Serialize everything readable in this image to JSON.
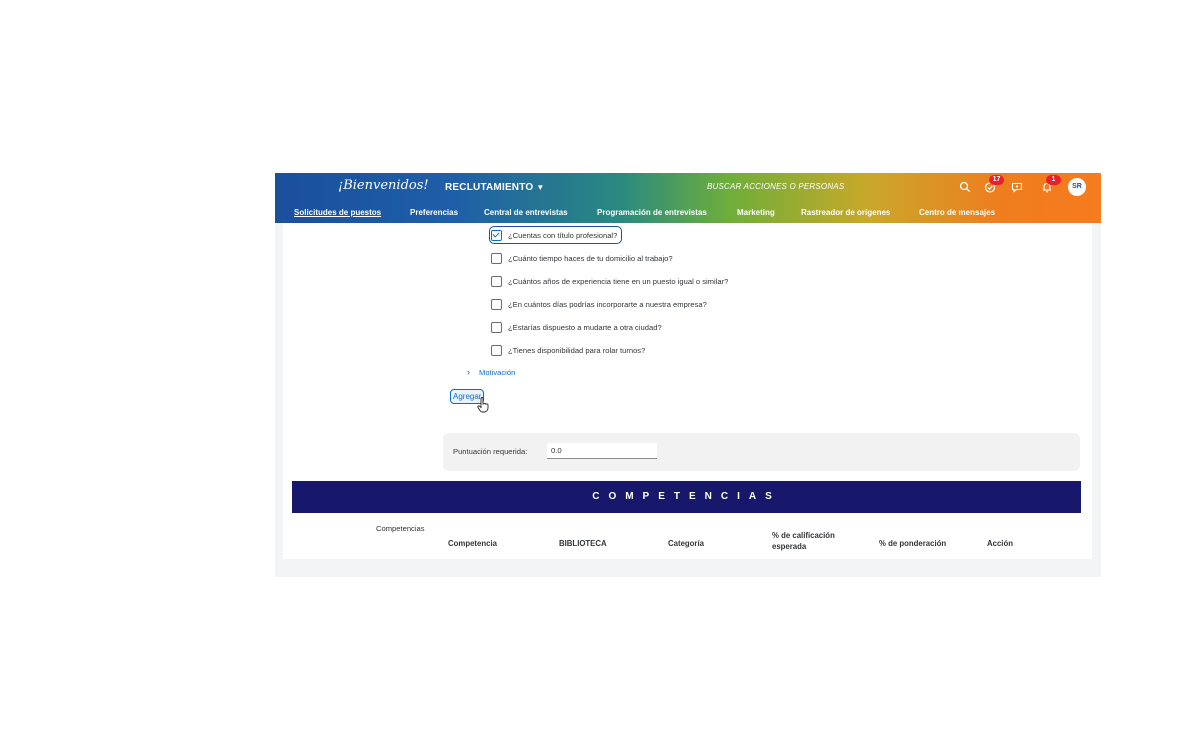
{
  "shell": {
    "logo_text": "¡Bienvenidos!",
    "app_title": "RECLUTAMIENTO",
    "search_placeholder": "BUSCAR ACCIONES O PERSONAS",
    "todo_badge": "17",
    "notifications_badge": "1",
    "avatar_initials": "SR"
  },
  "nav": {
    "items": [
      {
        "label": "Solicitudes de puestos",
        "active": true
      },
      {
        "label": "Preferencias"
      },
      {
        "label": "Central de entrevistas"
      },
      {
        "label": "Programación de entrevistas"
      },
      {
        "label": "Marketing"
      },
      {
        "label": "Rastreador de orígenes"
      },
      {
        "label": "Centro de mensajes"
      }
    ]
  },
  "questions": [
    {
      "label": "¿Cuentas con título profesional?",
      "checked": true
    },
    {
      "label": "¿Cuánto tiempo haces de tu domicilio al trabajo?",
      "checked": false
    },
    {
      "label": "¿Cuántos años de experiencia tiene en un puesto igual o similar?",
      "checked": false
    },
    {
      "label": "¿En cuántos días podrías incorporarte a nuestra empresa?",
      "checked": false
    },
    {
      "label": "¿Estarías dispuesto a mudarte a otra ciudad?",
      "checked": false
    },
    {
      "label": "¿Tienes disponibilidad para rolar turnos?",
      "checked": false
    }
  ],
  "motivacion_label": "Motivación",
  "add_button_label": "Agregar",
  "score": {
    "label": "Puntuación requerida:",
    "value": "0.0"
  },
  "competencias": {
    "banner_title": "COMPETENCIAS",
    "section_label": "Competencias",
    "columns": [
      "Competencia",
      "BIBLIOTECA",
      "Categoría",
      "% de calificación esperada",
      "% de ponderación",
      "Acción"
    ]
  },
  "colors": {
    "brand_blue": "#1a4f9c",
    "brand_orange": "#f57c1f",
    "banner_navy": "#17176b",
    "link_blue": "#0a6ed1",
    "badge_red": "#e9202b"
  }
}
